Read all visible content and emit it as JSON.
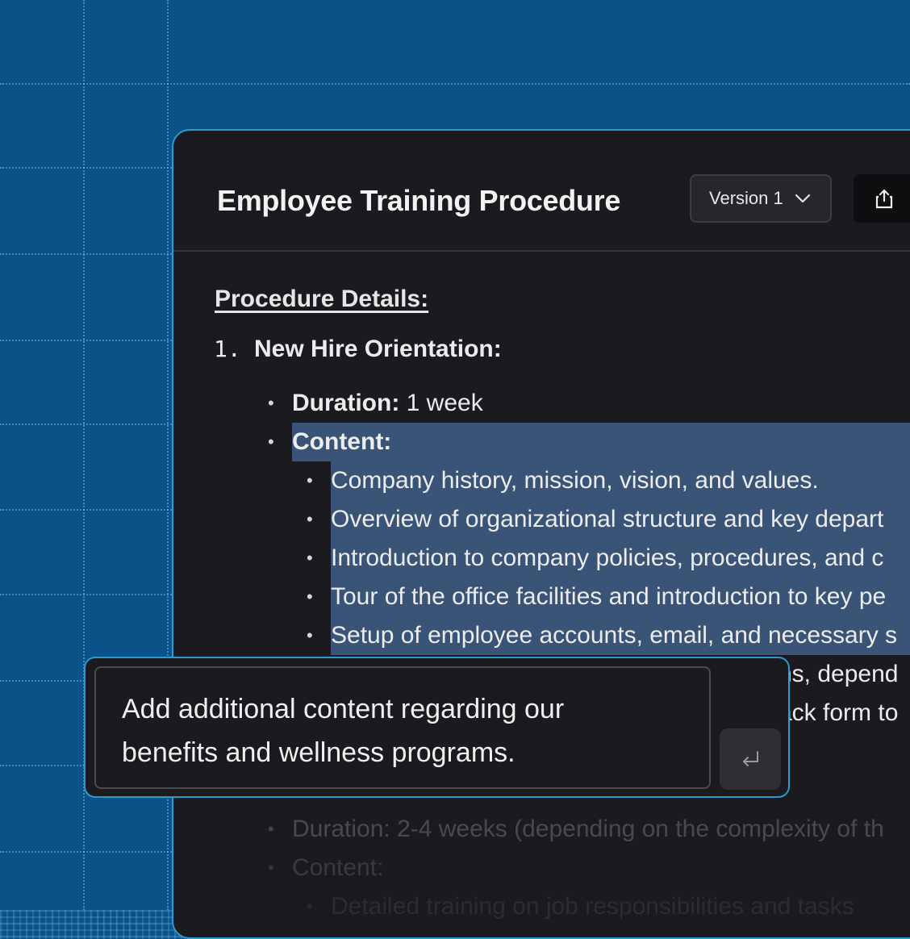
{
  "document": {
    "title": "Employee Training Procedure",
    "version_label": "Version 1",
    "section_heading": "Procedure Details:",
    "items": [
      {
        "number": "1.",
        "title": "New Hire Orientation:",
        "duration_label": "Duration:",
        "duration_value": " 1 week",
        "content_label": "Content:",
        "content_points": [
          "Company history, mission, vision, and values.",
          "Overview of organizational structure and key depart",
          "Introduction to company policies, procedures, and c",
          "Tour of the office facilities and introduction to key pe",
          "Setup of employee accounts, email, and necessary s"
        ],
        "partial_lines": [
          "ns, depend",
          "ack form to"
        ]
      }
    ],
    "faded_lines": [
      "Duration: 2-4 weeks (depending on the complexity of th",
      "Content:",
      "Detailed training on job responsibilities and tasks"
    ]
  },
  "prompt": {
    "text_line1": "Add additional content regarding our",
    "text_line2": "benefits and wellness programs.",
    "submit_icon": "enter-icon"
  },
  "colors": {
    "background": "#0b5289",
    "window": "#1b1b1f",
    "accent_border": "#2a9bd0",
    "selection": "#3a5478"
  }
}
